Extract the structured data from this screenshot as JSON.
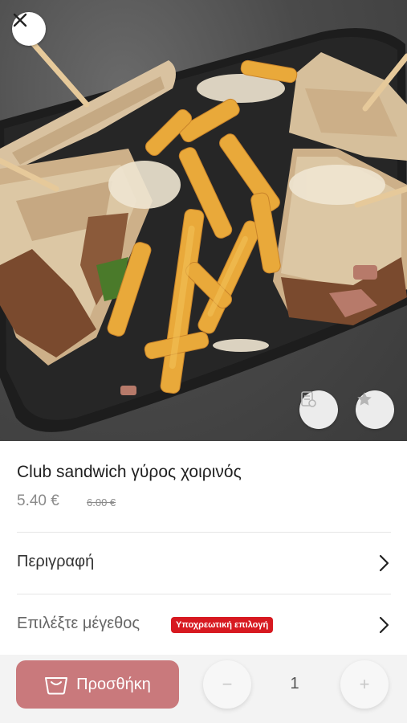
{
  "product": {
    "name": "Club sandwich γύρος χοιρινός",
    "price": "5.40 €",
    "old_price": "6.00 €"
  },
  "hero": {
    "image_icon": "food-photo",
    "close_icon": "close-icon",
    "menu_icon": "note-icon",
    "favorite_icon": "star-icon"
  },
  "rows": {
    "description_label": "Περιγραφή",
    "size_label": "Επιλέξτε μέγεθος",
    "size_required_badge": "Υποχρεωτική επιλογή"
  },
  "cart": {
    "add_label": "Προσθήκη",
    "quantity": "1",
    "minus_label": "−",
    "plus_label": "+"
  },
  "colors": {
    "accent": "#c9797c",
    "badge": "#d71920"
  }
}
